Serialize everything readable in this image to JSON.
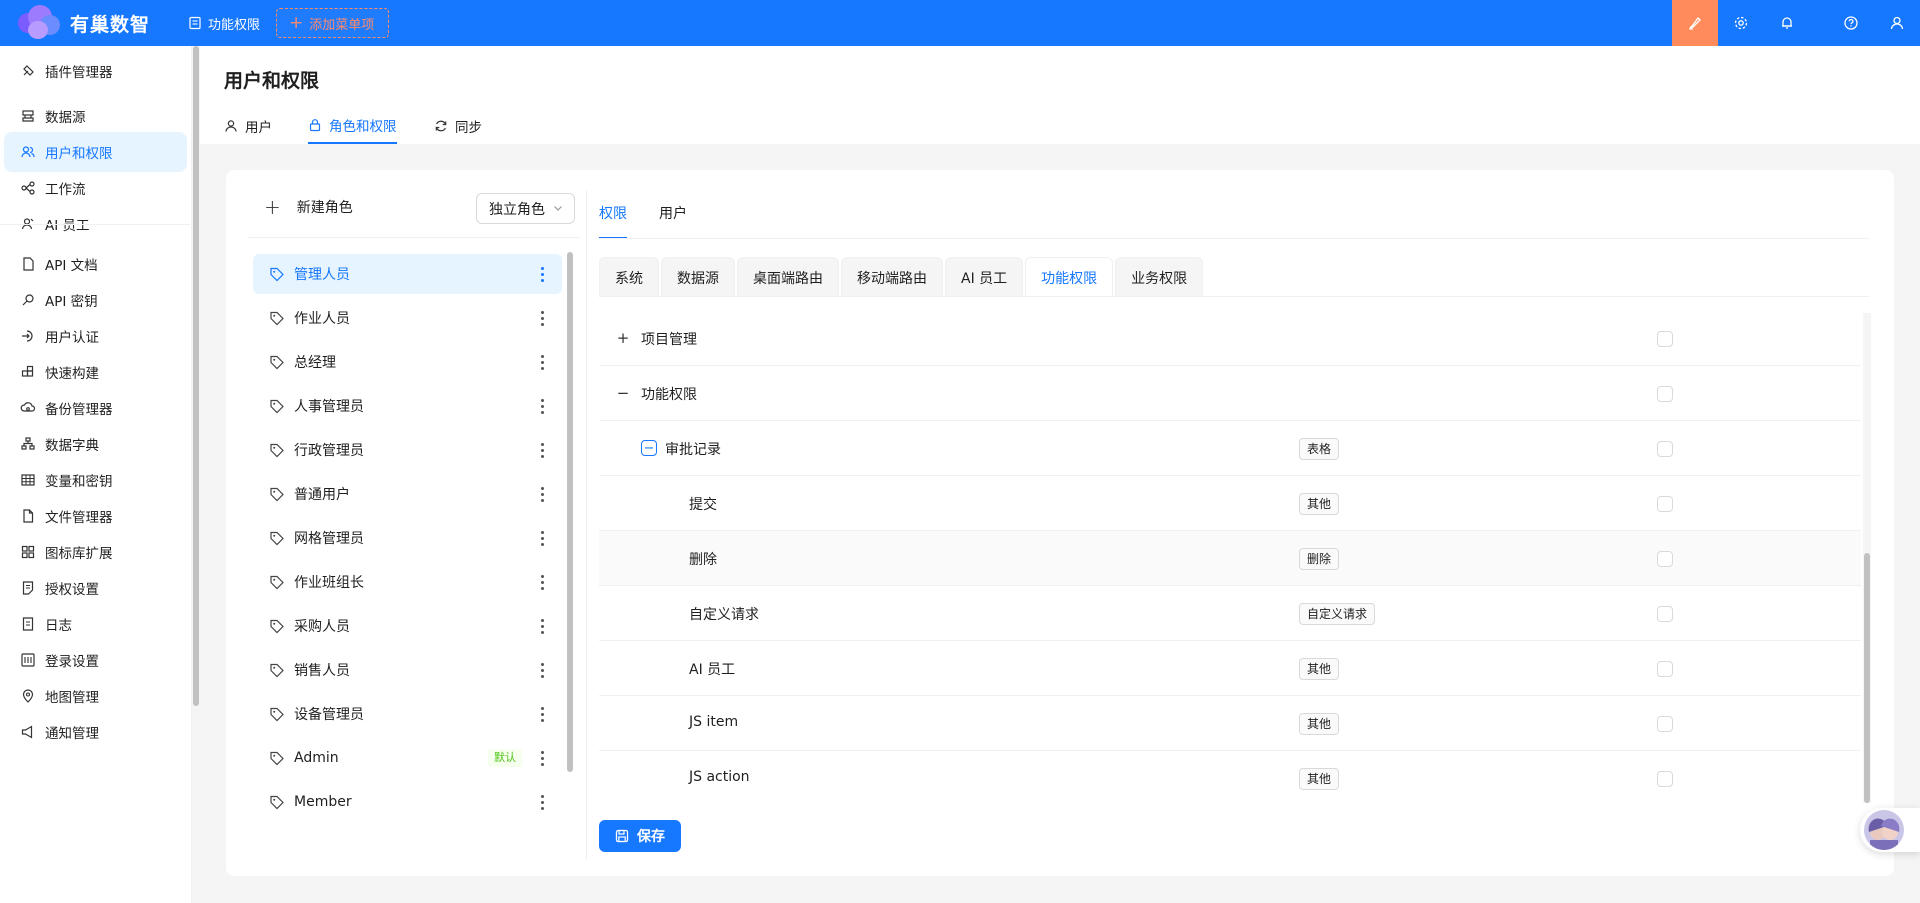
{
  "topbar": {
    "logo_text": "有巢数智",
    "menu_item": "功能权限",
    "add_menu": "添加菜单项",
    "accent_color": "#1677ff",
    "active_tool_color": "#ff8b5c",
    "right_icons": [
      "brush-icon",
      "gear-icon",
      "bell-icon",
      "help-icon",
      "user-icon"
    ]
  },
  "sidebar": {
    "items": [
      {
        "label": "插件管理器",
        "icon": "plugin-icon"
      },
      {
        "label": "数据源",
        "icon": "database-icon"
      },
      {
        "label": "用户和权限",
        "icon": "users-icon",
        "active": true
      },
      {
        "label": "工作流",
        "icon": "workflow-icon"
      },
      {
        "label": "AI 员工",
        "icon": "ai-employee-icon"
      },
      {
        "label": "API 文档",
        "icon": "document-icon"
      },
      {
        "label": "API 密钥",
        "icon": "key-icon"
      },
      {
        "label": "用户认证",
        "icon": "login-icon"
      },
      {
        "label": "快速构建",
        "icon": "blocks-icon"
      },
      {
        "label": "备份管理器",
        "icon": "cloud-icon"
      },
      {
        "label": "数据字典",
        "icon": "tree-icon"
      },
      {
        "label": "变量和密钥",
        "icon": "table-icon"
      },
      {
        "label": "文件管理器",
        "icon": "file-icon"
      },
      {
        "label": "图标库扩展",
        "icon": "grid-icon"
      },
      {
        "label": "授权设置",
        "icon": "license-icon"
      },
      {
        "label": "日志",
        "icon": "log-icon"
      },
      {
        "label": "登录设置",
        "icon": "login-settings-icon"
      },
      {
        "label": "地图管理",
        "icon": "location-icon"
      },
      {
        "label": "通知管理",
        "icon": "megaphone-icon"
      }
    ]
  },
  "page": {
    "title": "用户和权限",
    "tabs": [
      {
        "label": "用户",
        "icon": "user-icon"
      },
      {
        "label": "角色和权限",
        "icon": "lock-icon",
        "active": true
      },
      {
        "label": "同步",
        "icon": "sync-icon"
      }
    ]
  },
  "roles": {
    "new_role": "新建角色",
    "mode_select": "独立角色",
    "default_badge": "默认",
    "items": [
      {
        "label": "管理人员",
        "active": true
      },
      {
        "label": "作业人员"
      },
      {
        "label": "总经理"
      },
      {
        "label": "人事管理员"
      },
      {
        "label": "行政管理员"
      },
      {
        "label": "普通用户"
      },
      {
        "label": "网格管理员"
      },
      {
        "label": "作业班组长"
      },
      {
        "label": "采购人员"
      },
      {
        "label": "销售人员"
      },
      {
        "label": "设备管理员"
      },
      {
        "label": "Admin",
        "default": true
      },
      {
        "label": "Member"
      }
    ]
  },
  "perm_tabs": [
    {
      "label": "权限",
      "active": true
    },
    {
      "label": "用户"
    }
  ],
  "sub_tabs": [
    {
      "label": "系统"
    },
    {
      "label": "数据源"
    },
    {
      "label": "桌面端路由"
    },
    {
      "label": "移动端路由"
    },
    {
      "label": "AI 员工"
    },
    {
      "label": "功能权限",
      "active": true
    },
    {
      "label": "业务权限"
    }
  ],
  "permissions": [
    {
      "name": "项目管理",
      "level": 0,
      "expander": "+",
      "type": ""
    },
    {
      "name": "功能权限",
      "level": 0,
      "expander": "−",
      "type": ""
    },
    {
      "name": "审批记录",
      "level": 1,
      "expander": "−",
      "type": "表格"
    },
    {
      "name": "提交",
      "level": 2,
      "type": "其他"
    },
    {
      "name": "删除",
      "level": 2,
      "type": "删除",
      "hover": true
    },
    {
      "name": "自定义请求",
      "level": 2,
      "type": "自定义请求"
    },
    {
      "name": "AI 员工",
      "level": 2,
      "type": "其他"
    },
    {
      "name": "JS item",
      "level": 2,
      "type": "其他"
    },
    {
      "name": "JS action",
      "level": 2,
      "type": "其他"
    }
  ],
  "save_label": "保存"
}
